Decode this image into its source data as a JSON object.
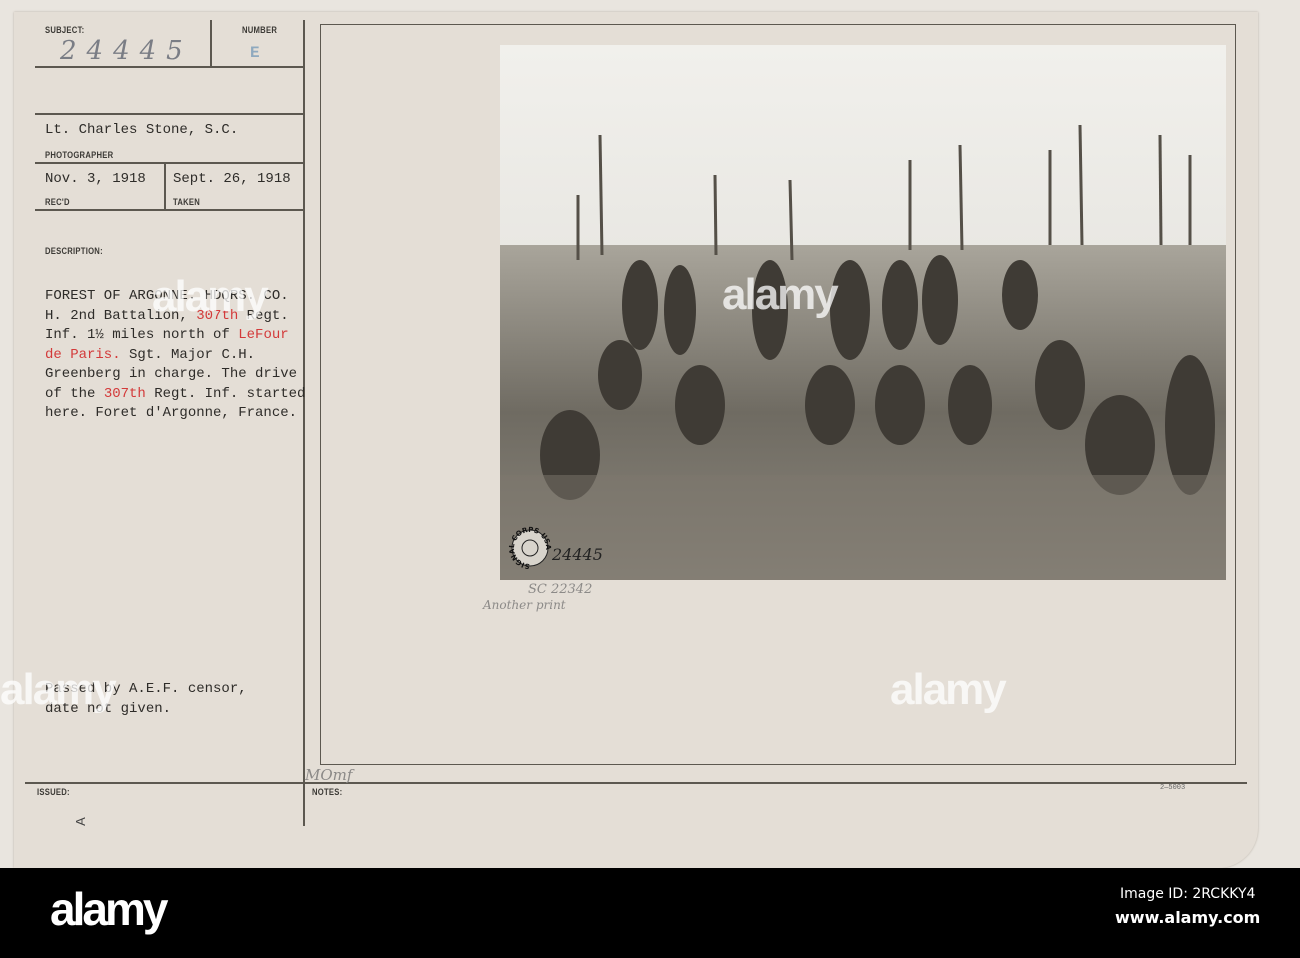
{
  "record": {
    "subject_label": "SUBJECT:",
    "subject_value": "24445",
    "number_label": "NUMBER",
    "number_value": "E",
    "photographer": "Lt. Charles Stone, S.C.",
    "photographer_label": "PHOTOGRAPHER",
    "received": "Nov. 3, 1918",
    "received_label": "REC'D",
    "taken": "Sept. 26, 1918",
    "taken_label": "TAKEN",
    "description_label": "DESCRIPTION:",
    "description_lines": [
      [
        "FOREST OF ARGONNE. HDQRS. CO.",
        "",
        ""
      ],
      [
        "H. 2nd Battalion, ",
        "307th",
        " Regt."
      ],
      [
        "Inf. 1½ miles north of ",
        "LeFour",
        ""
      ],
      [
        "",
        "de Paris.",
        " Sgt. Major C.H."
      ],
      [
        "Greenberg in charge. The drive",
        "",
        ""
      ],
      [
        "of the ",
        "307th",
        " Regt. Inf. started"
      ],
      [
        "here. Foret d'Argonne, France.",
        "",
        ""
      ]
    ],
    "censor_line1": "Passed by A.E.F. censor,",
    "censor_line2": "date not given.",
    "issued_label": "ISSUED:",
    "issued_mark": "A",
    "notes_label": "NOTES:",
    "notes_pencil": "MOmf",
    "form_number": "2—5003"
  },
  "photo": {
    "stamp": "SIGNAL CORPS USA",
    "handwritten_number": "24445",
    "below_number": "SC 22342",
    "below_note": "Another print"
  },
  "colors": {
    "highlight": "#d33a3a",
    "card": "#e4ded6"
  },
  "watermark": {
    "logo": "alamy",
    "image_id": "Image ID: 2RCKKY4",
    "site": "www.alamy.com"
  }
}
